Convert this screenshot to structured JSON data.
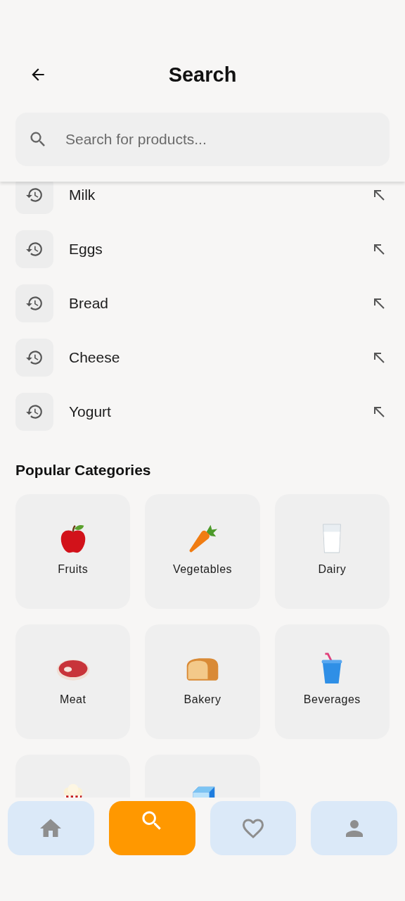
{
  "header": {
    "title": "Search"
  },
  "search": {
    "placeholder": "Search for products..."
  },
  "recent_searches": [
    {
      "label": "Milk"
    },
    {
      "label": "Eggs"
    },
    {
      "label": "Bread"
    },
    {
      "label": "Cheese"
    },
    {
      "label": "Yogurt"
    }
  ],
  "popular_categories": {
    "title": "Popular Categories",
    "items": [
      {
        "kind": "apple",
        "label": "Fruits"
      },
      {
        "kind": "carrot",
        "label": "Vegetables"
      },
      {
        "kind": "milk",
        "label": "Dairy"
      },
      {
        "kind": "meat",
        "label": "Meat"
      },
      {
        "kind": "bread",
        "label": "Bakery"
      },
      {
        "kind": "cup",
        "label": "Beverages"
      },
      {
        "kind": "popcorn"
      },
      {
        "kind": "ice"
      }
    ]
  },
  "bottom_nav": [
    {
      "kind": "home",
      "selected": false
    },
    {
      "kind": "search",
      "selected": true
    },
    {
      "kind": "favorites",
      "selected": false
    },
    {
      "kind": "profile",
      "selected": false
    }
  ]
}
